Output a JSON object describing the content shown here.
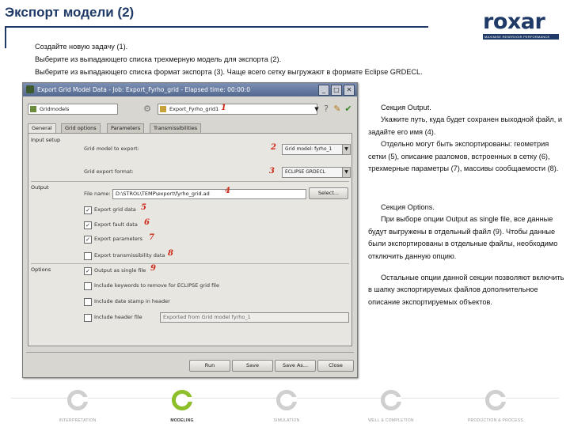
{
  "slide": {
    "title": "Экспорт модели (2)",
    "logo_word": "roxar",
    "logo_tagline": "MAXIMISE RESERVOIR PERFORMANCE",
    "intro_lines": [
      "Создайте новую задачу (1).",
      "Выберите из выпадающего списка трехмерную модель для экспорта (2).",
      "Выберите из выпадающего списка формат экспорта (3). Чаще всего сетку выгружают в формате Eclipse GRDECL."
    ]
  },
  "window": {
    "title": "Export Grid Model Data - Job: Export_Fyrho_grid - Elapsed time: 00:00:0",
    "buttons": {
      "minimize": "_",
      "maximize": "□",
      "close": "✕"
    },
    "toolbar": {
      "left_field": "Gridmodels",
      "job_field": "Export_Fyrho_grid1"
    },
    "tabs": [
      "General",
      "Grid options",
      "Parameters",
      "Transmissibilities"
    ],
    "sections": {
      "input": "Input setup",
      "output": "Output",
      "options": "Options"
    },
    "input": {
      "grid_model_label": "Grid model to export:",
      "grid_model_value": "Grid model: fyrho_1",
      "format_label": "Grid export format:",
      "format_value": "ECLIPSE GRDECL"
    },
    "output": {
      "file_label": "File name:",
      "file_value": "D:\\STROL\\TEMP\\export\\fyrho_grid.ad",
      "select_button": "Select...",
      "checkboxes": [
        {
          "label": "Export grid data",
          "checked": true,
          "marker": "5"
        },
        {
          "label": "Export fault data",
          "checked": true,
          "marker": "6"
        },
        {
          "label": "Export parameters",
          "checked": true,
          "marker": "7"
        },
        {
          "label": "Export transmissibility data",
          "checked": false,
          "marker": "8"
        }
      ]
    },
    "options": {
      "checkboxes": [
        {
          "label": "Output as single file",
          "checked": true,
          "marker": "9"
        },
        {
          "label": "Include keywords to remove for ECLIPSE grid file",
          "checked": false
        },
        {
          "label": "Include date stamp in header",
          "checked": false
        },
        {
          "label": "Include header file",
          "checked": false
        }
      ],
      "header_field": "Exported from Grid model fyrho_1"
    },
    "markers": {
      "job": "1",
      "grid_model": "2",
      "format": "3",
      "file": "4"
    },
    "footer_buttons": [
      "Run",
      "Save",
      "Save As...",
      "Close"
    ]
  },
  "right_text": {
    "output_section": [
      "Секция Output.",
      "Укажите путь, куда будет сохранен выходной файл, и задайте его имя (4).",
      "Отдельно могут быть экспортированы: геометрия сетки (5), описание разломов, встроенных в сетку (6), трехмерные параметры (7), массивы сообщаемости (8)."
    ],
    "options_section": [
      "Секция Options.",
      "При выборе опции Output as single file, все данные будут выгружены в отдельный файл (9). Чтобы данные были экспортированы в отдельные файлы, необходимо отключить данную опцию.",
      "Остальные опции данной секции позволяют включить в шапку экспортируемых файлов дополнительное описание экспортируемых объектов."
    ]
  },
  "footer_nav": [
    {
      "label": "INTERPRETATION",
      "active": false
    },
    {
      "label": "MODELING",
      "active": true
    },
    {
      "label": "SIMULATION",
      "active": false
    },
    {
      "label": "WELL & COMPLETION",
      "active": false
    },
    {
      "label": "PRODUCTION & PROCESS",
      "active": false
    }
  ],
  "colors": {
    "title": "#1f3a66",
    "accent_marker": "#cc2a1a",
    "active_nav": "#8cbf2a"
  }
}
